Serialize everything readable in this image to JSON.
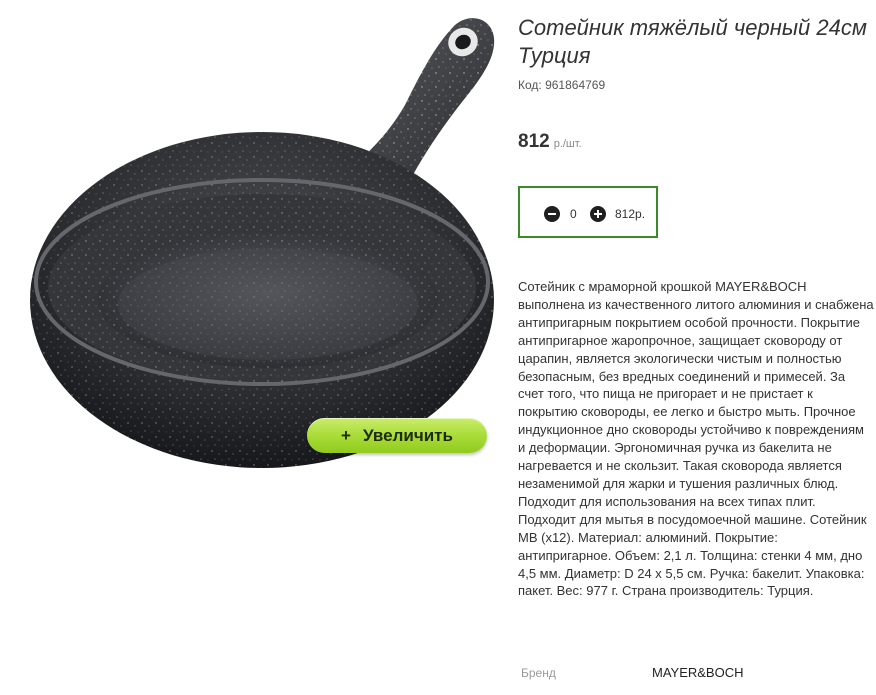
{
  "product": {
    "title": "Сотейник тяжёлый черный 24см Турция",
    "code_label": "Код: 961864769",
    "price_value": "812",
    "price_unit": "р./шт.",
    "zoom_button_label": "Увеличить",
    "zoom_button_icon": "plus-icon",
    "image_alt": "pan-image"
  },
  "cart": {
    "quantity": "0",
    "total": "812р.",
    "minus_icon": "minus-circle-icon",
    "plus_icon": "plus-circle-icon",
    "border_color": "#3a8a26"
  },
  "description": "Сотейник с мраморной крошкой MAYER&BOCH выполнена из качественного литого алюминия и снабжена антипригарным покрытием особой прочности. Покрытие антипригарное жаропрочное, защищает сковороду от царапин, является экологически чистым и полностью безопасным, без вредных соединений и примесей. За счет того, что пища не пригорает и не пристает к покрытию сковороды, ее легко и быстро мыть. Прочное индукционное дно сковороды устойчиво к повреждениям и деформации. Эргономичная ручка из бакелита не нагревается и не скользит. Такая сковорода является незаменимой для жарки и тушения различных блюд. Подходит для использования на всех типах плит. Подходит для мытья в посудомоечной машине. Сотейник MB (x12). Материал: алюминий. Покрытие: антипригарное. Объем: 2,1 л. Толщина: стенки 4 мм, дно 4,5 мм. Диаметр: D 24 х 5,5 см. Ручка: бакелит. Упаковка: пакет. Вес: 977 г. Страна производитель: Турция.",
  "brand": {
    "label": "Бренд",
    "value": "MAYER&BOCH"
  },
  "colors": {
    "zoom_button": "#a9dc38",
    "pan_body": "#2e2f33",
    "text": "#333333"
  }
}
